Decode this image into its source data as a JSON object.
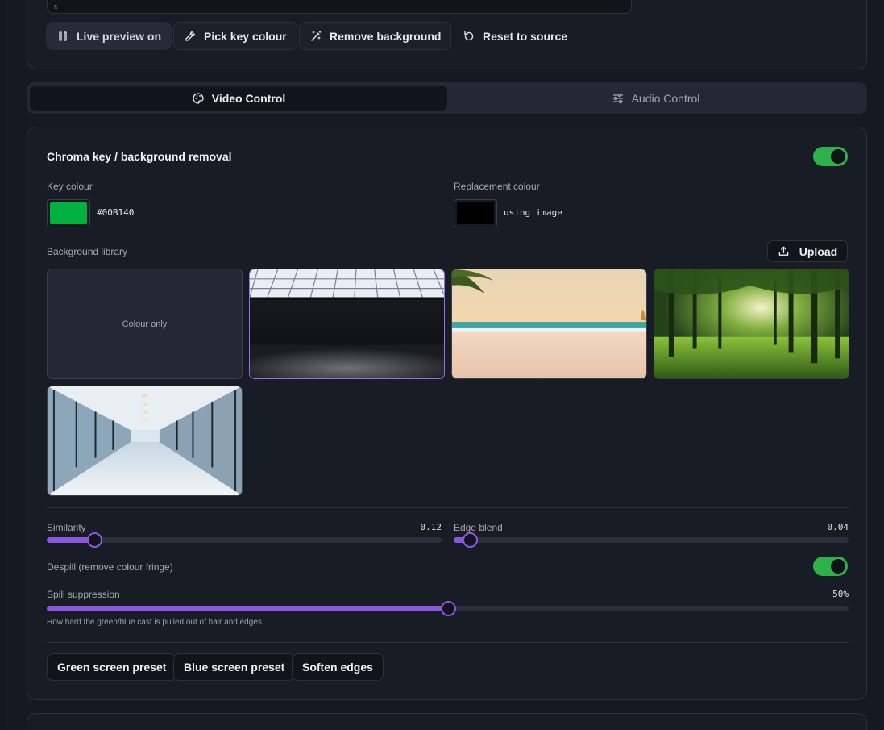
{
  "preview": {
    "corner_label": "R"
  },
  "actions": {
    "live_preview": "Live preview on",
    "pick_key": "Pick key colour",
    "remove_bg": "Remove background",
    "reset": "Reset to source"
  },
  "tabs": [
    {
      "label": "Video Control",
      "icon": "palette-icon",
      "active": true
    },
    {
      "label": "Audio Control",
      "icon": "sliders-icon",
      "active": false
    }
  ],
  "chroma": {
    "title": "Chroma key / background removal",
    "enabled": true,
    "key_colour_label": "Key colour",
    "key_colour_value": "#00B140",
    "key_colour_hex": "#00b140",
    "replacement_label": "Replacement colour",
    "replacement_value": "using image",
    "replacement_hex": "#000000",
    "library_label": "Background library",
    "upload_label": "Upload",
    "colour_only_label": "Colour only",
    "backgrounds": [
      "studio",
      "beach",
      "forest",
      "office"
    ],
    "selected_background": "studio",
    "similarity_label": "Similarity",
    "similarity_value": "0.12",
    "similarity_level": 0.12,
    "edge_blend_label": "Edge blend",
    "edge_blend_value": "0.04",
    "edge_blend_level": 0.04,
    "despill_label": "Despill (remove colour fringe)",
    "despill_enabled": true,
    "spill_label": "Spill suppression",
    "spill_value": "50%",
    "spill_level": 0.5,
    "spill_hint": "How hard the green/blue cast is pulled out of hair and edges.",
    "presets": [
      "Green screen preset",
      "Blue screen preset",
      "Soften edges"
    ]
  },
  "colors": {
    "accent": "#8b57e0",
    "toggle_on": "#2bb34a"
  }
}
